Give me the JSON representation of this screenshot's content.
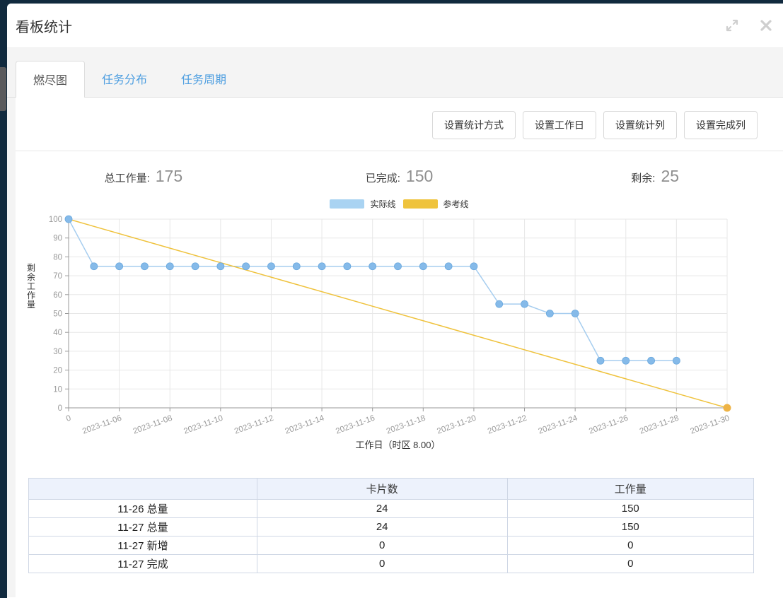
{
  "dialog": {
    "title": "看板统计",
    "icons": {
      "expand": "expand-diagonal-arrows",
      "close": "x-cross"
    }
  },
  "tabs": [
    {
      "label": "燃尽图",
      "active": true
    },
    {
      "label": "任务分布",
      "active": false
    },
    {
      "label": "任务周期",
      "active": false
    }
  ],
  "toolbar": {
    "buttons": [
      "设置统计方式",
      "设置工作日",
      "设置统计列",
      "设置完成列"
    ]
  },
  "stats": [
    {
      "label": "总工作量:",
      "value": "175"
    },
    {
      "label": "已完成:",
      "value": "150"
    },
    {
      "label": "剩余:",
      "value": "25"
    }
  ],
  "chart_data": {
    "type": "line",
    "title": "",
    "xlabel": "工作日（时区 8.00）",
    "ylabel": "剩余工作量",
    "ylim": [
      0,
      100
    ],
    "xlim": [
      0,
      26
    ],
    "grid": true,
    "legend_position": "top-center",
    "legend": [
      {
        "name": "实际线",
        "color": "#A9D3F2"
      },
      {
        "name": "参考线",
        "color": "#EFC33C"
      }
    ],
    "y_ticks": [
      0,
      10,
      20,
      30,
      40,
      50,
      60,
      70,
      80,
      90,
      100
    ],
    "x_ticks": [
      {
        "day": 0,
        "label": "0"
      },
      {
        "day": 2,
        "label": "2023-11-06"
      },
      {
        "day": 4,
        "label": "2023-11-08"
      },
      {
        "day": 6,
        "label": "2023-11-10"
      },
      {
        "day": 8,
        "label": "2023-11-12"
      },
      {
        "day": 10,
        "label": "2023-11-14"
      },
      {
        "day": 12,
        "label": "2023-11-16"
      },
      {
        "day": 14,
        "label": "2023-11-18"
      },
      {
        "day": 16,
        "label": "2023-11-20"
      },
      {
        "day": 18,
        "label": "2023-11-22"
      },
      {
        "day": 20,
        "label": "2023-11-24"
      },
      {
        "day": 22,
        "label": "2023-11-26"
      },
      {
        "day": 24,
        "label": "2023-11-28"
      },
      {
        "day": 26,
        "label": "2023-11-30"
      }
    ],
    "series": [
      {
        "name": "实际线",
        "color": "#A6CDEF",
        "marker_color": "#85BAE9",
        "marker_stroke": "#69A8DE",
        "points": [
          [
            0,
            100
          ],
          [
            1,
            75
          ],
          [
            2,
            75
          ],
          [
            3,
            75
          ],
          [
            4,
            75
          ],
          [
            5,
            75
          ],
          [
            6,
            75
          ],
          [
            7,
            75
          ],
          [
            8,
            75
          ],
          [
            9,
            75
          ],
          [
            10,
            75
          ],
          [
            11,
            75
          ],
          [
            12,
            75
          ],
          [
            13,
            75
          ],
          [
            14,
            75
          ],
          [
            15,
            75
          ],
          [
            16,
            75
          ],
          [
            17,
            55
          ],
          [
            18,
            55
          ],
          [
            19,
            50
          ],
          [
            20,
            50
          ],
          [
            21,
            25
          ],
          [
            22,
            25
          ],
          [
            23,
            25
          ],
          [
            24,
            25
          ]
        ]
      },
      {
        "name": "参考线",
        "color": "#EFC23C",
        "marker_color": "#EEB345",
        "points": [
          [
            0,
            100
          ],
          [
            26,
            0
          ]
        ]
      }
    ]
  },
  "table": {
    "headers": [
      "",
      "卡片数",
      "工作量"
    ],
    "rows": [
      [
        "11-26 总量",
        "24",
        "150"
      ],
      [
        "11-27 总量",
        "24",
        "150"
      ],
      [
        "11-27 新增",
        "0",
        "0"
      ],
      [
        "11-27 完成",
        "0",
        "0"
      ]
    ]
  },
  "colors": {
    "page_background": "#112A3E",
    "tab_link": "#4D9EE0",
    "table_header_bg": "#EDF2FC",
    "table_border": "#CFD7E5",
    "axis": "#999999",
    "gridline": "#E7E7E7"
  }
}
